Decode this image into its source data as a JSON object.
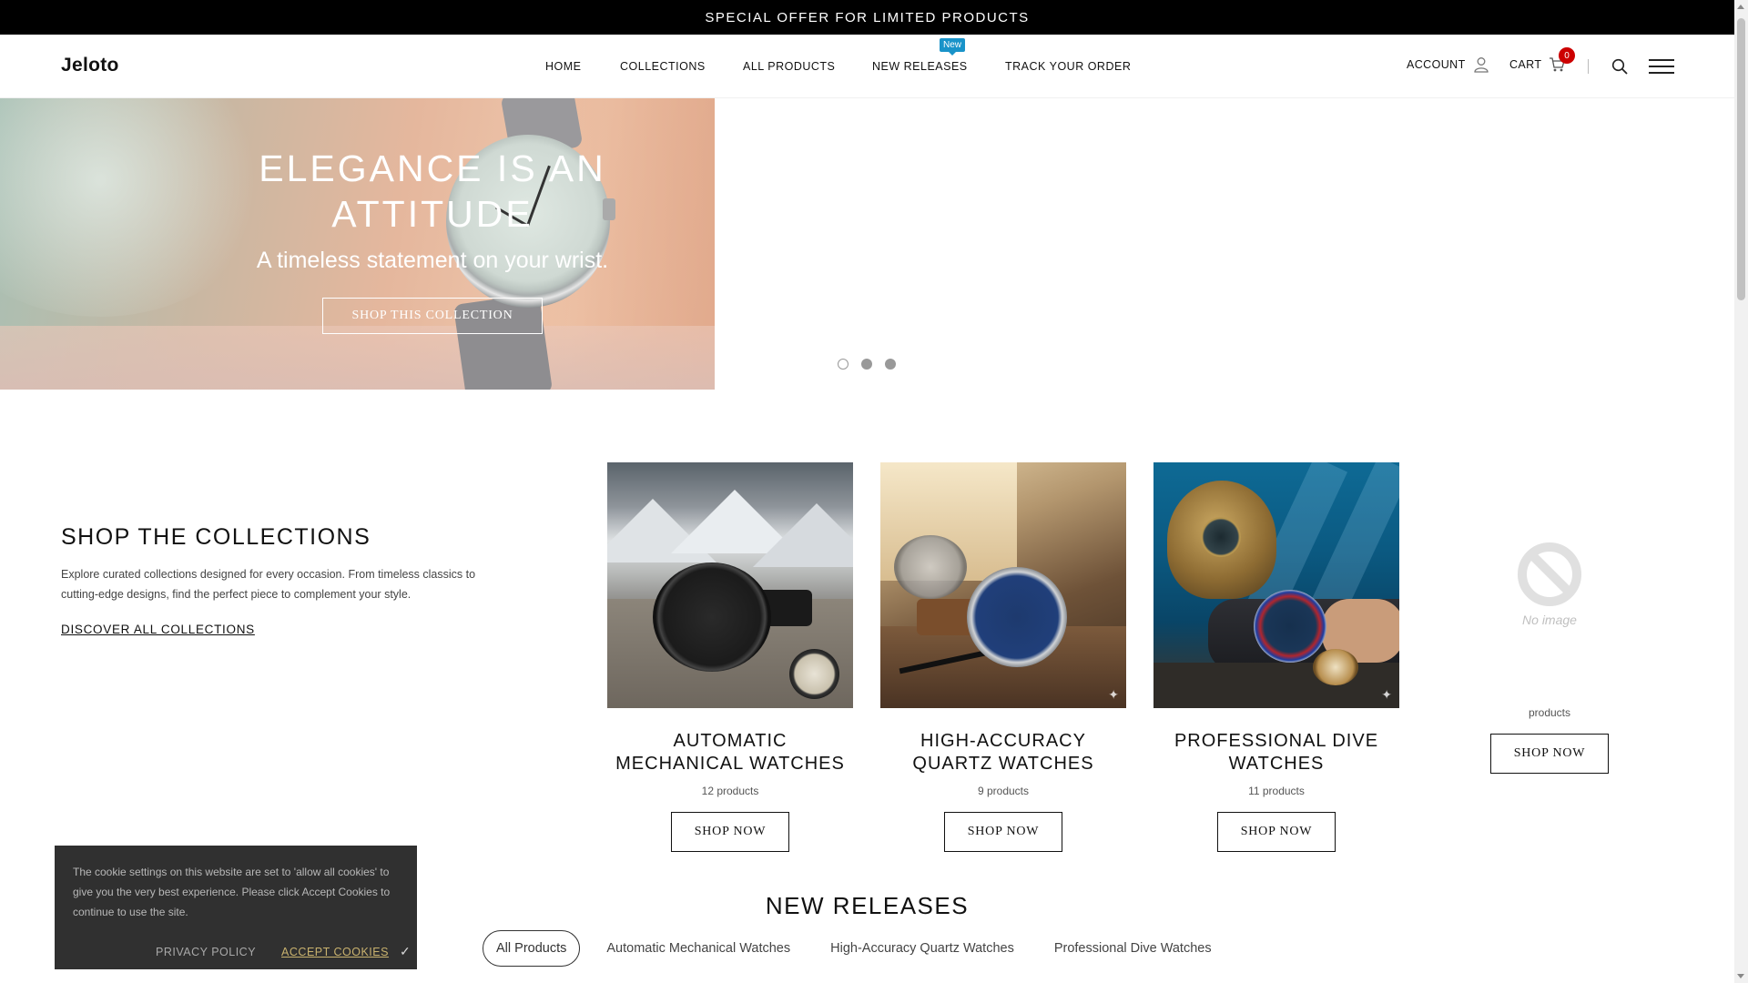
{
  "announcement": "SPECIAL OFFER FOR LIMITED PRODUCTS",
  "header": {
    "logo": "Jeloto",
    "nav": [
      "HOME",
      "COLLECTIONS",
      "ALL PRODUCTS",
      "NEW RELEASES",
      "TRACK YOUR ORDER"
    ],
    "new_badge": "New",
    "account_label": "ACCOUNT",
    "cart_label": "CART",
    "cart_count": "0",
    "icons": [
      "user-icon",
      "cart-icon",
      "search-icon",
      "hamburger-menu-icon"
    ]
  },
  "hero": {
    "title": "ELEGANCE IS AN ATTITUDE",
    "subtitle": "A timeless statement on your wrist.",
    "button": "SHOP THIS COLLECTION",
    "slides": 3,
    "active_slide": 1
  },
  "collections": {
    "title": "SHOP THE COLLECTIONS",
    "description": "Explore curated collections designed for every occasion. From timeless classics to cutting-edge designs, find the perfect piece to complement your style.",
    "link": "DISCOVER ALL COLLECTIONS",
    "cards": [
      {
        "name": "AUTOMATIC MECHANICAL WATCHES",
        "count": "12 products",
        "button": "SHOP NOW"
      },
      {
        "name": "HIGH-ACCURACY QUARTZ WATCHES",
        "count": "9 products",
        "button": "SHOP NOW"
      },
      {
        "name": "PROFESSIONAL DIVE WATCHES",
        "count": "11 products",
        "button": "SHOP NOW"
      },
      {
        "name": "",
        "count": "products",
        "button": "SHOP NOW",
        "placeholder": "No image"
      }
    ]
  },
  "new_releases": {
    "title": "NEW RELEASES",
    "filters": [
      "All Products",
      "Automatic Mechanical Watches",
      "High-Accuracy Quartz Watches",
      "Professional Dive Watches"
    ],
    "active_filter": "All Products"
  },
  "cookie": {
    "text": "The cookie settings on this website are set to 'allow all cookies' to give you the very best experience. Please click Accept Cookies to continue to use the site.",
    "privacy": "PRIVACY POLICY",
    "accept": "ACCEPT COOKIES"
  },
  "colors": {
    "announcement_bg": "#000000",
    "new_badge": "#1993c9",
    "cart_badge": "#cc0000",
    "cookie_accept": "#c9b26e"
  }
}
